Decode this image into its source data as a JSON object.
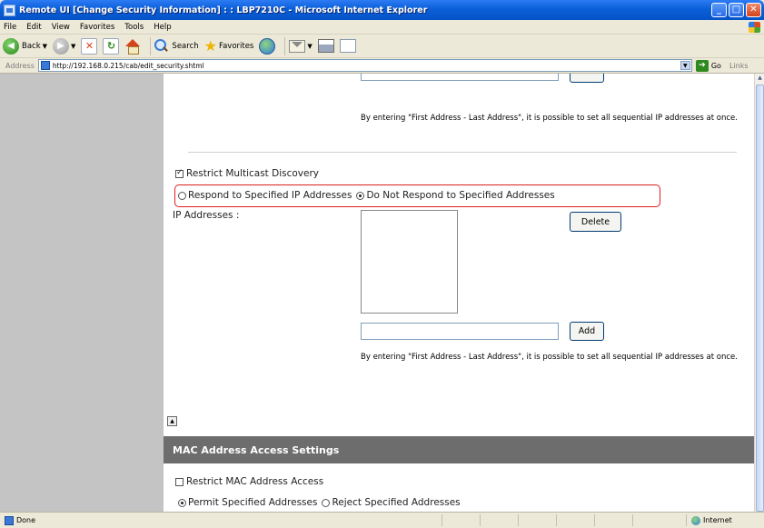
{
  "window": {
    "title": "Remote UI [Change Security Information] : : LBP7210C - Microsoft Internet Explorer",
    "minimize": "_",
    "maximize": "□",
    "close": "✕"
  },
  "menu": [
    "File",
    "Edit",
    "View",
    "Favorites",
    "Tools",
    "Help"
  ],
  "toolbar": {
    "back": "Back",
    "search": "Search",
    "favorites": "Favorites"
  },
  "address": {
    "label": "Address",
    "url": "http://192.168.0.215/cab/edit_security.shtml",
    "go": "Go",
    "links": "Links"
  },
  "ip_section_top": {
    "note": "By entering \"First Address - Last Address\", it is possible to set all sequential IP addresses at once."
  },
  "multicast": {
    "checkbox_label": "Restrict Multicast Discovery",
    "checked": true,
    "radio_respond": "Respond to Specified IP Addresses",
    "radio_not_respond": "Do Not Respond to Specified Addresses",
    "selected": "not_respond",
    "ip_label": "IP Addresses :",
    "delete_button": "Delete",
    "add_button": "Add",
    "note": "By entering \"First Address - Last Address\", it is possible to set all sequential IP addresses at once."
  },
  "mac_section": {
    "header": "MAC Address Access Settings",
    "checkbox_label": "Restrict MAC Address Access",
    "checked": false,
    "radio_permit": "Permit Specified Addresses",
    "radio_reject": "Reject Specified Addresses",
    "selected": "permit"
  },
  "statusbar": {
    "status": "Done",
    "zone": "Internet"
  },
  "colors": {
    "titlebar": "#0a5fd8",
    "highlight_border": "#e01e1e",
    "section_header_bg": "#6d6d6d",
    "left_panel": "#c4c4c4"
  }
}
